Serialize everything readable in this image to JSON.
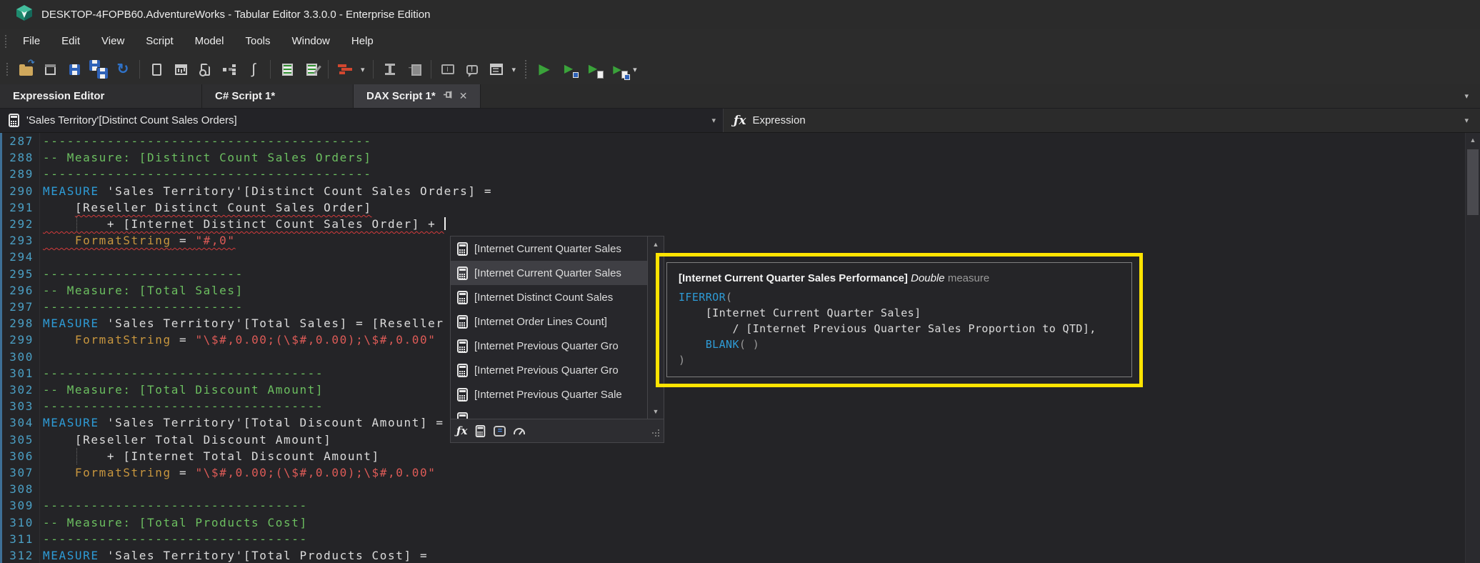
{
  "window": {
    "title": "DESKTOP-4FOPB60.AdventureWorks - Tabular Editor 3.3.0.0 - Enterprise Edition"
  },
  "menu": {
    "items": [
      "File",
      "Edit",
      "View",
      "Script",
      "Model",
      "Tools",
      "Window",
      "Help"
    ]
  },
  "toolbar": {
    "items": [
      "open-file",
      "deploy",
      "save",
      "save-all",
      "refresh",
      "sep",
      "new-document",
      "pivot-grid",
      "report-page",
      "diagram",
      "macro",
      "sep",
      "script-list",
      "script-edit",
      "sep",
      "best-practice",
      "arrow",
      "sep",
      "column-width",
      "import-table",
      "sep",
      "frame",
      "comment",
      "window-layout",
      "arrow",
      "dotsep",
      "play",
      "play-save",
      "play-script",
      "play-script-save",
      "arrow"
    ]
  },
  "tabs": [
    {
      "label": "Expression Editor",
      "active": false
    },
    {
      "label": "C# Script 1*",
      "active": false
    },
    {
      "label": "DAX Script 1*",
      "active": true,
      "pinned": true,
      "closable": true
    }
  ],
  "expression_bar": {
    "selected": "'Sales Territory'[Distinct Count Sales Orders]",
    "label": "Expression"
  },
  "editor": {
    "lines": [
      {
        "n": 287,
        "seg": [
          [
            "cmt",
            "-----------------------------------------"
          ]
        ]
      },
      {
        "n": 288,
        "seg": [
          [
            "cmt",
            "-- Measure: [Distinct Count Sales Orders]"
          ]
        ]
      },
      {
        "n": 289,
        "seg": [
          [
            "cmt",
            "-----------------------------------------"
          ]
        ]
      },
      {
        "n": 290,
        "seg": [
          [
            "kw",
            "MEASURE"
          ],
          [
            "pl",
            " 'Sales Territory'[Distinct Count Sales Orders] ="
          ]
        ]
      },
      {
        "n": 291,
        "seg": [
          [
            "pl",
            "    "
          ],
          [
            "pl sq",
            "[Reseller Distinct Count Sales Order]"
          ]
        ]
      },
      {
        "n": 292,
        "seg": [
          [
            "pl sq",
            "        + [Internet Distinct Count Sales Order] + "
          ]
        ],
        "caret": true,
        "guide": true
      },
      {
        "n": 293,
        "seg": [
          [
            "fs sq",
            "    FormatString"
          ],
          [
            "pl sq",
            " = "
          ],
          [
            "str sq",
            "\"#,0\""
          ]
        ]
      },
      {
        "n": 294,
        "seg": []
      },
      {
        "n": 295,
        "seg": [
          [
            "cmt",
            "-------------------------"
          ]
        ]
      },
      {
        "n": 296,
        "seg": [
          [
            "cmt",
            "-- Measure: [Total Sales]"
          ]
        ]
      },
      {
        "n": 297,
        "seg": [
          [
            "cmt",
            "-------------------------"
          ]
        ]
      },
      {
        "n": 298,
        "seg": [
          [
            "kw",
            "MEASURE"
          ],
          [
            "pl",
            " 'Sales Territory'[Total Sales] = [Reseller "
          ]
        ]
      },
      {
        "n": 299,
        "seg": [
          [
            "fs",
            "    FormatString"
          ],
          [
            "pl",
            " = "
          ],
          [
            "str",
            "\"\\$#,0.00;(\\$#,0.00);\\$#,0.00\""
          ]
        ]
      },
      {
        "n": 300,
        "seg": []
      },
      {
        "n": 301,
        "seg": [
          [
            "cmt",
            "-----------------------------------"
          ]
        ]
      },
      {
        "n": 302,
        "seg": [
          [
            "cmt",
            "-- Measure: [Total Discount Amount]"
          ]
        ]
      },
      {
        "n": 303,
        "seg": [
          [
            "cmt",
            "-----------------------------------"
          ]
        ]
      },
      {
        "n": 304,
        "seg": [
          [
            "kw",
            "MEASURE"
          ],
          [
            "pl",
            " 'Sales Territory'[Total Discount Amount] ="
          ]
        ]
      },
      {
        "n": 305,
        "seg": [
          [
            "pl",
            "    [Reseller Total Discount Amount]"
          ]
        ]
      },
      {
        "n": 306,
        "seg": [
          [
            "pl",
            "        + [Internet Total Discount Amount]"
          ]
        ],
        "guide": true
      },
      {
        "n": 307,
        "seg": [
          [
            "fs",
            "    FormatString"
          ],
          [
            "pl",
            " = "
          ],
          [
            "str",
            "\"\\$#,0.00;(\\$#,0.00);\\$#,0.00\""
          ]
        ]
      },
      {
        "n": 308,
        "seg": []
      },
      {
        "n": 309,
        "seg": [
          [
            "cmt",
            "---------------------------------"
          ]
        ]
      },
      {
        "n": 310,
        "seg": [
          [
            "cmt",
            "-- Measure: [Total Products Cost]"
          ]
        ]
      },
      {
        "n": 311,
        "seg": [
          [
            "cmt",
            "---------------------------------"
          ]
        ]
      },
      {
        "n": 312,
        "seg": [
          [
            "kw",
            "MEASURE"
          ],
          [
            "pl",
            " 'Sales Territory'[Total Products Cost] ="
          ]
        ]
      }
    ]
  },
  "autocomplete": {
    "items": [
      {
        "label": "[Internet Current Quarter Sales",
        "selected": false
      },
      {
        "label": "[Internet Current Quarter Sales",
        "selected": true
      },
      {
        "label": "[Internet Distinct Count Sales",
        "selected": false
      },
      {
        "label": "[Internet Order Lines Count]",
        "selected": false
      },
      {
        "label": "[Internet Previous Quarter Gro",
        "selected": false
      },
      {
        "label": "[Internet Previous Quarter Gro",
        "selected": false
      },
      {
        "label": "[Internet Previous Quarter Sale",
        "selected": false
      },
      {
        "label": "",
        "selected": false,
        "partial": true
      }
    ],
    "footer_icons": [
      "expression",
      "measure",
      "column",
      "kpi"
    ]
  },
  "tooltip": {
    "title": "[Internet Current Quarter Sales Performance]",
    "type": "Double",
    "kind": "measure",
    "lines": [
      [
        [
          "kw",
          "IFERROR"
        ],
        [
          "gr",
          "("
        ]
      ],
      [
        [
          "pl",
          "    [Internet Current Quarter Sales]"
        ]
      ],
      [
        [
          "pl",
          "        / [Internet Previous Quarter Sales Proportion to QTD],"
        ]
      ],
      [
        [
          "pl",
          "    "
        ],
        [
          "kw",
          "BLANK"
        ],
        [
          "gr",
          "( )"
        ]
      ],
      [
        [
          "gr",
          ")"
        ]
      ]
    ]
  },
  "colors": {
    "keyword": "#2E9BD6",
    "comment": "#6CBF60",
    "string": "#DE5B57",
    "format_string": "#C8963E",
    "line_number": "#4B9FC4",
    "tooltip_border": "#FFE400",
    "error_underline": "#D23B3B",
    "run_green": "#3AA23A",
    "logo_green": "#43BD9C"
  }
}
